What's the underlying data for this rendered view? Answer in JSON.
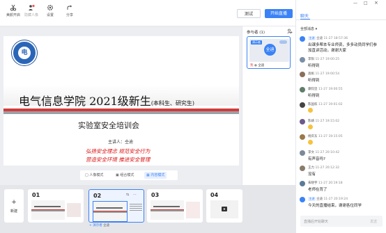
{
  "toolbar": {
    "tools": [
      {
        "label": "美颜开启",
        "icon": "scissors-icon"
      },
      {
        "label": "隐藏人像",
        "icon": "hide-person-icon"
      },
      {
        "label": "设置",
        "icon": "gear-icon"
      },
      {
        "label": "分享",
        "icon": "share-icon"
      }
    ],
    "test_label": "测试",
    "start_label": "开始直播"
  },
  "slide": {
    "logo_text": "电",
    "title_main": "电气信息学院 2021级新生",
    "title_sub": "(本科生、研究生)",
    "subtitle": "实验室安全培训会",
    "speaker": "主讲人：仝迪",
    "slogan1": "弘扬安全理念 规范安全行为",
    "slogan2": "营造安全环境 推进安全管理"
  },
  "modes": [
    "人像模式",
    "组合模式",
    "内容模式"
  ],
  "participants": {
    "title": "参与者 (1)",
    "card_badge": "演示者",
    "avatar": "全迪",
    "name": "仝迪",
    "name_prefix": "我"
  },
  "slides_panel": {
    "new_label": "新建",
    "numbers": [
      "01",
      "02",
      "03",
      "04"
    ],
    "presenter_label": "+ 演示者",
    "presenter_name": "仝迪"
  },
  "chat": {
    "tab": "聊天",
    "filter": "全部消息",
    "messages": [
      {
        "name": "仝迪",
        "lecturer": true,
        "time": "11-27 18:57:36",
        "text": "出课多帮本专业师资，多多动员同学们参",
        "text2": "加直讲活动，谢谢大家",
        "color": "#3b82f6"
      },
      {
        "name": "李阳",
        "lecturer": false,
        "time": "11-27 19:00:25",
        "text": "听得到",
        "color": "#7a8fa8"
      },
      {
        "name": "高帆",
        "lecturer": false,
        "time": "11-27 19:00:54",
        "text": "听得到",
        "color": "#8b6f5a"
      },
      {
        "name": "康钧坚",
        "lecturer": false,
        "time": "11-27 19:00:55",
        "text": "听得到",
        "color": "#5f7d6a"
      },
      {
        "name": "陈国栋",
        "lecturer": false,
        "time": "11-27 19:01:02",
        "text": "",
        "emoji": true,
        "color": "#444"
      },
      {
        "name": "陈靖",
        "lecturer": false,
        "time": "11-27 19:15:02",
        "text": "",
        "emoji": true,
        "color": "#6c5a8a"
      },
      {
        "name": "杨庆东",
        "lecturer": false,
        "time": "11-27 19:15:05",
        "text": "",
        "emoji": true,
        "color": "#9a7a4a"
      },
      {
        "name": "李文",
        "lecturer": false,
        "time": "11-27 20:10:42",
        "text": "有声音吗?",
        "color": "#7c8a9a"
      },
      {
        "name": "王力",
        "lecturer": false,
        "time": "11-27 20:12:32",
        "text": "没有",
        "color": "#8a7c6a"
      },
      {
        "name": "朱晓宇",
        "lecturer": false,
        "time": "11-27 20:19:18",
        "text": "老师在背了",
        "color": "#5a7a9a"
      },
      {
        "name": "仝迪",
        "lecturer": true,
        "time": "11-27 20:19:24",
        "text": "今天的直播结束，谢谢各位同学",
        "color": "#3b82f6"
      }
    ],
    "input_placeholder": "直播后开始聊天",
    "send_label": "发送"
  }
}
